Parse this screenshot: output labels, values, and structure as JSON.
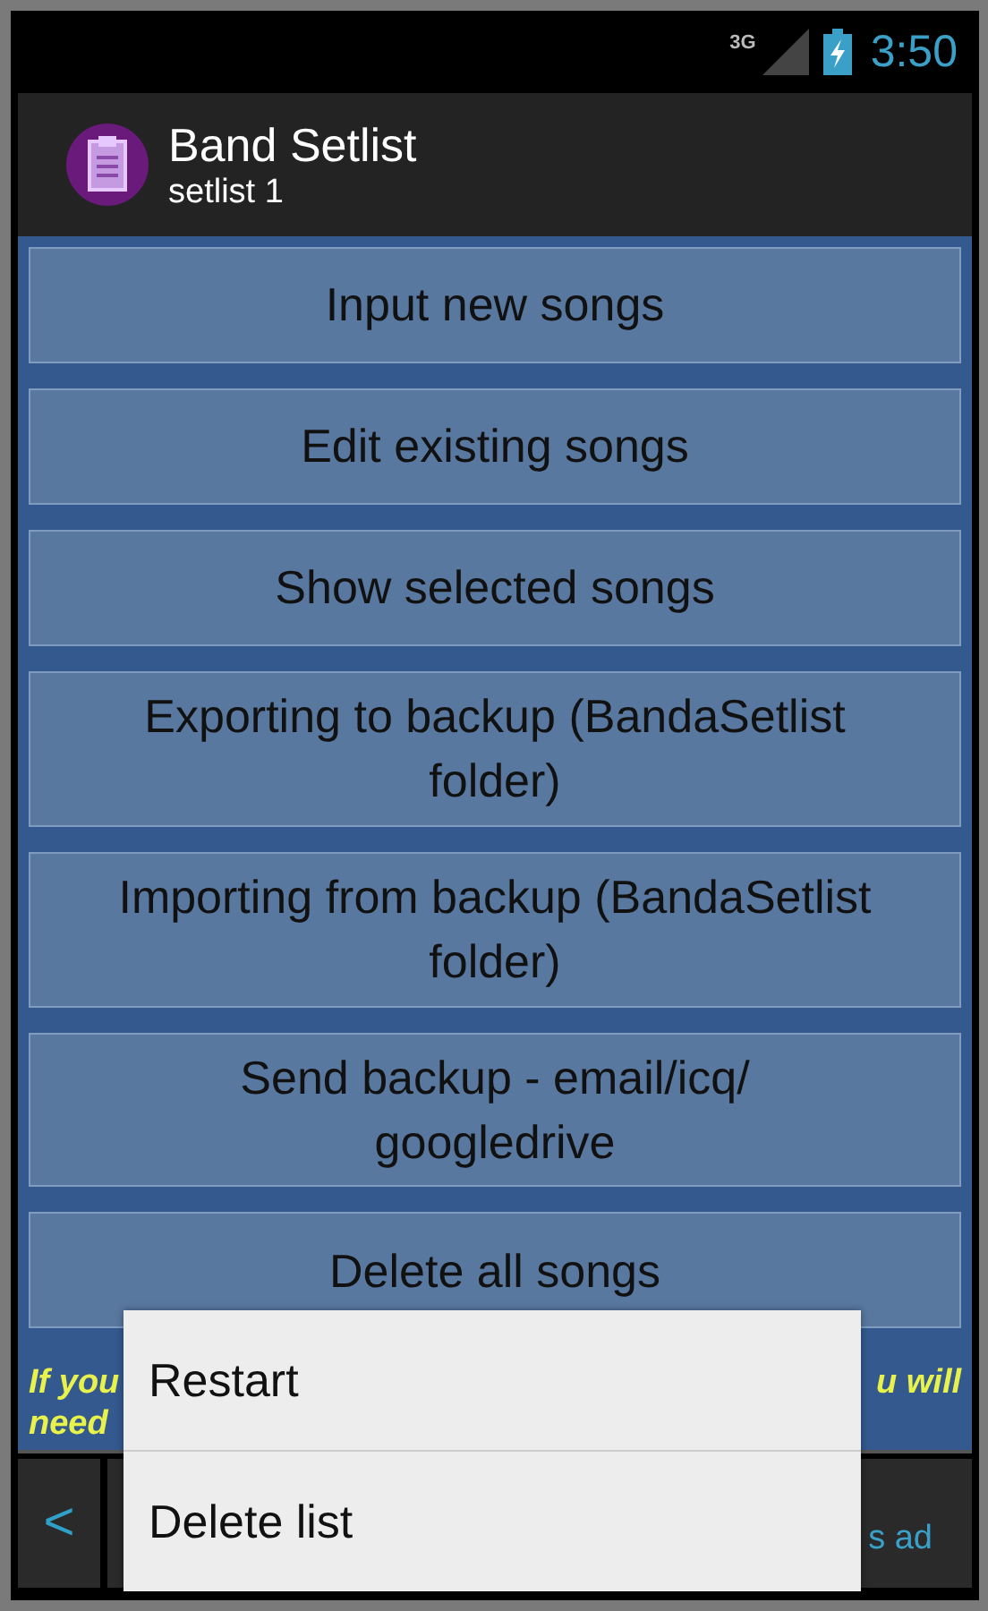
{
  "status_bar": {
    "network": "3G",
    "time": "3:50"
  },
  "action_bar": {
    "title": "Band Setlist",
    "subtitle": "setlist 1"
  },
  "buttons": [
    "Input new songs",
    "Edit existing songs",
    "Show selected songs",
    "Exporting to backup (BandaSetlist folder)",
    "Importing from backup (BandaSetlist folder)",
    "Send backup - email/icq/ googledrive",
    "Delete all songs"
  ],
  "notice": {
    "line_1_left": "If you",
    "line_1_right": "u will",
    "line_2_left": "need"
  },
  "ad_bar": {
    "back": "<",
    "text": "s ad"
  },
  "popup_menu": {
    "items": [
      "Restart",
      "Delete list"
    ]
  }
}
